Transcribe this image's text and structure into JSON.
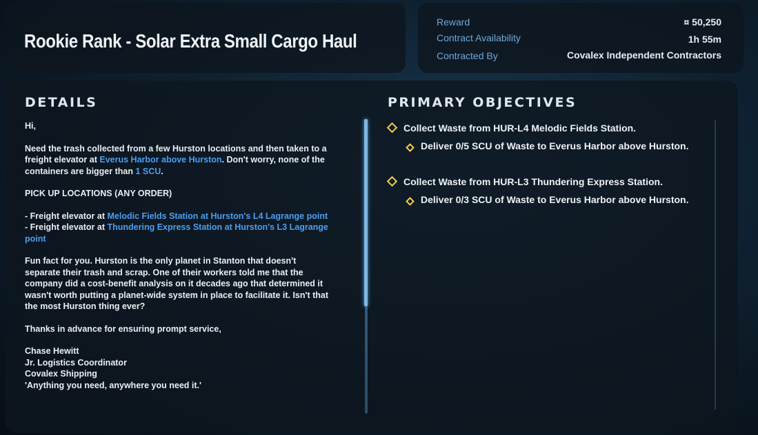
{
  "contract": {
    "title": "Rookie Rank - Solar Extra Small Cargo Haul"
  },
  "meta": {
    "reward_label": "Reward",
    "reward_value": "¤ 50,250",
    "availability_label": "Contract Availability",
    "availability_value": "1h 55m",
    "contracted_by_label": "Contracted By",
    "contracted_by_value": "Covalex Independent Contractors"
  },
  "details": {
    "heading": "DETAILS",
    "greeting": "Hi,",
    "intro_1": "Need the trash collected from a few Hurston locations and then taken to a freight elevator at ",
    "intro_link_1": "Everus Harbor above Hurston",
    "intro_2": ". Don't worry, none of the containers are bigger than ",
    "intro_link_2": "1 SCU",
    "intro_3": ".",
    "pickup_heading": "PICK UP LOCATIONS (ANY ORDER)",
    "pickup_1_prefix": "- Freight elevator at ",
    "pickup_1_link": "Melodic Fields Station at Hurston's L4 Lagrange point",
    "pickup_2_prefix": "- Freight elevator at ",
    "pickup_2_link": "Thundering Express Station at Hurston's L3 Lagrange point",
    "fun_fact": "Fun fact for you. Hurston is the only planet in Stanton that doesn't separate their trash and scrap. One of their workers told me that the company did a cost-benefit analysis on it decades ago that determined it wasn't worth putting a planet-wide system in place to facilitate it. Isn't that the most Hurston thing ever?",
    "thanks": "Thanks in advance for ensuring prompt service,",
    "sig_name": "Chase Hewitt",
    "sig_title": "Jr. Logistics Coordinator",
    "sig_company": "Covalex Shipping",
    "sig_motto": "'Anything you need, anywhere you need it.'"
  },
  "objectives": {
    "heading": "PRIMARY OBJECTIVES",
    "items": [
      {
        "label": "Collect Waste from HUR-L4 Melodic Fields Station.",
        "sub": "Deliver 0/5 SCU of Waste to Everus Harbor above Hurston."
      },
      {
        "label": "Collect Waste from HUR-L3 Thundering Express Station.",
        "sub": "Deliver 0/3 SCU of Waste to Everus Harbor above Hurston."
      }
    ]
  },
  "colors": {
    "accent_link": "#4c9ef0",
    "objective_marker": "#f2d04a",
    "meta_label": "#6fa9d8"
  }
}
